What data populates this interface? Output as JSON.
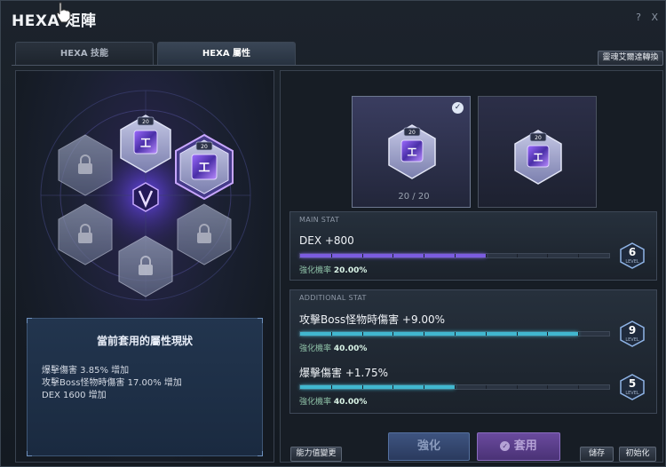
{
  "window": {
    "title": "HEXA 矩陣",
    "help": "?",
    "close": "X"
  },
  "tabs": [
    {
      "label": "HEXA 技能"
    },
    {
      "label": "HEXA 屬性"
    }
  ],
  "convert_button": "靈魂艾爾達轉換",
  "matrix": {
    "slot_level": "20"
  },
  "status": {
    "title": "當前套用的屬性現狀",
    "lines": [
      "爆擊傷害 3.85% 增加",
      "攻擊Boss怪物時傷害 17.00% 增加",
      "DEX 1600 增加"
    ]
  },
  "cards": [
    {
      "level": "20",
      "selected": true
    },
    {
      "level": "20",
      "selected": false
    }
  ],
  "card_count": "20 / 20",
  "main_stat": {
    "label": "MAIN STAT",
    "text": "DEX +800",
    "rate_label": "強化機率",
    "rate_value": "20.00%",
    "level": "6",
    "level_caption": "LEVEL",
    "progress": 0.6
  },
  "additional_stat": {
    "label": "ADDITIONAL STAT",
    "items": [
      {
        "text": "攻擊Boss怪物時傷害 +9.00%",
        "rate_label": "強化機率",
        "rate_value": "40.00%",
        "level": "9",
        "level_caption": "LEVEL",
        "progress": 0.9
      },
      {
        "text": "爆擊傷害 +1.75%",
        "rate_label": "強化機率",
        "rate_value": "40.00%",
        "level": "5",
        "level_caption": "LEVEL",
        "progress": 0.5
      }
    ]
  },
  "buttons": {
    "change_ability": "能力值變更",
    "enhance": "強化",
    "apply": "套用",
    "save": "儲存",
    "reset": "初始化"
  },
  "colors": {
    "accent_purple": "#8a5cf6",
    "bar_blue": "#3d8fd6",
    "bar_cyan": "#47c6d8"
  }
}
